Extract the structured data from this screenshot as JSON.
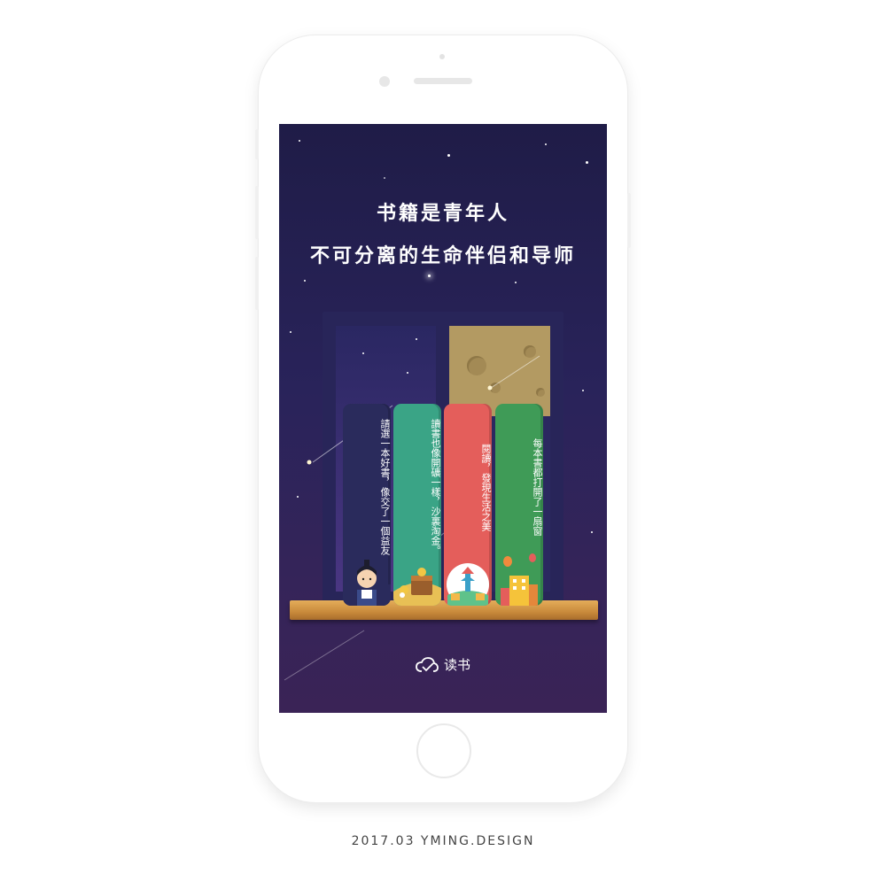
{
  "screen": {
    "headline_line1": "书籍是青年人",
    "headline_line2": "不可分离的生命伴侣和导师",
    "app_name": "读书",
    "books": [
      {
        "title": "請選一本好書，像交了一個益友",
        "color": "#2a2b5c"
      },
      {
        "title": "讀書也像開礦一樣，沙裏淘金。",
        "color": "#3aa486"
      },
      {
        "title": "閱讀，發現生活之美",
        "color": "#e45e5b"
      },
      {
        "title": "每本書都打開了一扇窗",
        "color": "#3f9b57"
      }
    ]
  },
  "caption": "2017.03 YMING.DESIGN",
  "icons": {
    "logo": "cloud-check-icon"
  },
  "colors": {
    "sky_top": "#1f1c47",
    "sky_bottom": "#3a2356",
    "shelf": "#d9994a"
  }
}
